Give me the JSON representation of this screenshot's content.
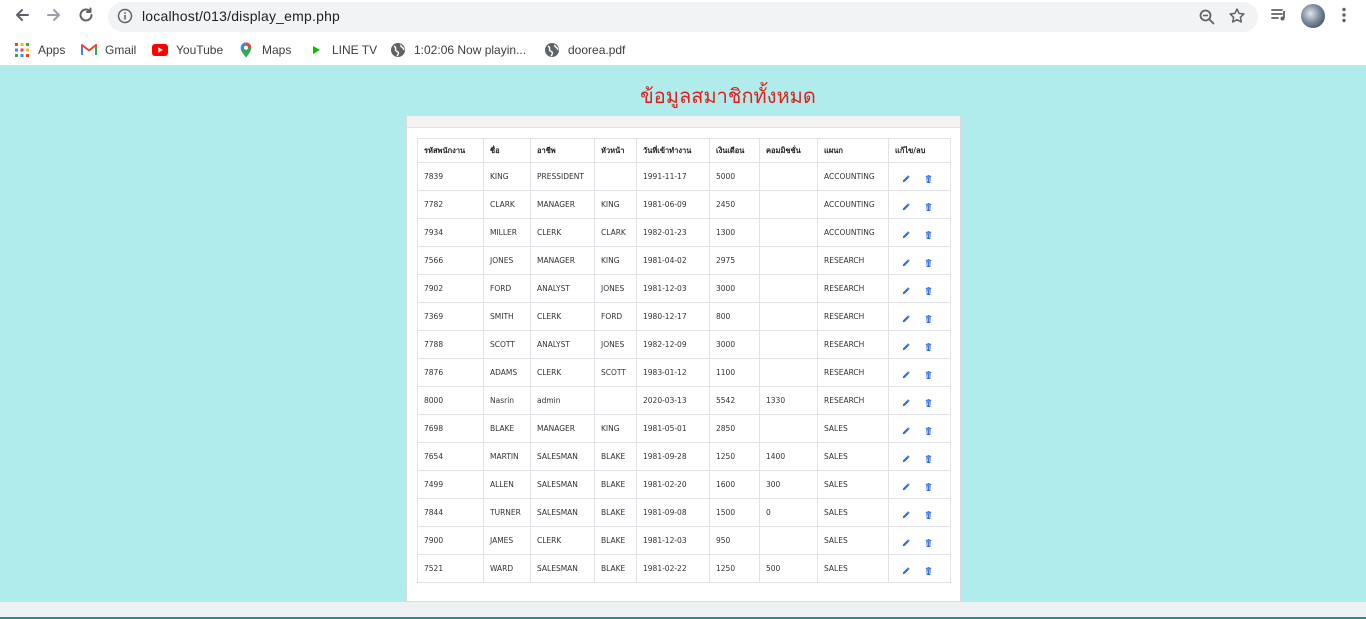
{
  "browser": {
    "url": "localhost/013/display_emp.php",
    "bookmarks": [
      {
        "label": "Apps",
        "icon": "apps-grid-icon"
      },
      {
        "label": "Gmail",
        "icon": "gmail-icon"
      },
      {
        "label": "YouTube",
        "icon": "youtube-icon"
      },
      {
        "label": "Maps",
        "icon": "maps-icon"
      },
      {
        "label": "LINE TV",
        "icon": "line-tv-icon"
      },
      {
        "label": "1:02:06 Now playin...",
        "icon": "globe-icon"
      },
      {
        "label": "doorea.pdf",
        "icon": "globe-icon"
      }
    ]
  },
  "page": {
    "title": "ข้อมูลสมาชิกทั้งหมด",
    "title_color": "#e0201c",
    "background": "#b0ecec"
  },
  "table": {
    "headers": [
      "รหัสพนักงาน",
      "ชื่อ",
      "อาชีพ",
      "หัวหน้า",
      "วันที่เข้าทำงาน",
      "เงินเดือน",
      "คอมมิชชั่น",
      "แผนก",
      "แก้ไข/ลบ"
    ],
    "rows": [
      [
        "7839",
        "KING",
        "PRESSIDENT",
        "",
        "1991-11-17",
        "5000",
        "",
        "ACCOUNTING"
      ],
      [
        "7782",
        "CLARK",
        "MANAGER",
        "KING",
        "1981-06-09",
        "2450",
        "",
        "ACCOUNTING"
      ],
      [
        "7934",
        "MILLER",
        "CLERK",
        "CLARK",
        "1982-01-23",
        "1300",
        "",
        "ACCOUNTING"
      ],
      [
        "7566",
        "JONES",
        "MANAGER",
        "KING",
        "1981-04-02",
        "2975",
        "",
        "RESEARCH"
      ],
      [
        "7902",
        "FORD",
        "ANALYST",
        "JONES",
        "1981-12-03",
        "3000",
        "",
        "RESEARCH"
      ],
      [
        "7369",
        "SMITH",
        "CLERK",
        "FORD",
        "1980-12-17",
        "800",
        "",
        "RESEARCH"
      ],
      [
        "7788",
        "SCOTT",
        "ANALYST",
        "JONES",
        "1982-12-09",
        "3000",
        "",
        "RESEARCH"
      ],
      [
        "7876",
        "ADAMS",
        "CLERK",
        "SCOTT",
        "1983-01-12",
        "1100",
        "",
        "RESEARCH"
      ],
      [
        "8000",
        "Nasrin",
        "admin",
        "",
        "2020-03-13",
        "5542",
        "1330",
        "RESEARCH"
      ],
      [
        "7698",
        "BLAKE",
        "MANAGER",
        "KING",
        "1981-05-01",
        "2850",
        "",
        "SALES"
      ],
      [
        "7654",
        "MARTIN",
        "SALESMAN",
        "BLAKE",
        "1981-09-28",
        "1250",
        "1400",
        "SALES"
      ],
      [
        "7499",
        "ALLEN",
        "SALESMAN",
        "BLAKE",
        "1981-02-20",
        "1600",
        "300",
        "SALES"
      ],
      [
        "7844",
        "TURNER",
        "SALESMAN",
        "BLAKE",
        "1981-09-08",
        "1500",
        "0",
        "SALES"
      ],
      [
        "7900",
        "JAMES",
        "CLERK",
        "BLAKE",
        "1981-12-03",
        "950",
        "",
        "SALES"
      ],
      [
        "7521",
        "WARD",
        "SALESMAN",
        "BLAKE",
        "1981-02-22",
        "1250",
        "500",
        "SALES"
      ]
    ],
    "action_icons": {
      "edit": "pencil-icon",
      "delete": "trash-icon"
    },
    "action_color": "#2f6fdc"
  }
}
